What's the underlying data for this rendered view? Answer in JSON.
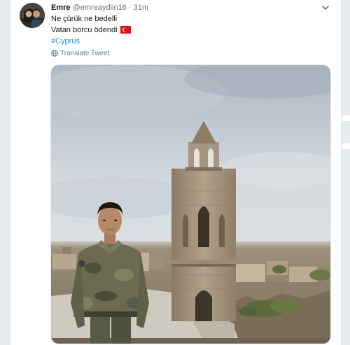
{
  "tweet": {
    "author_name": "Emre",
    "author_handle": "@emreaydiin16",
    "separator": " · ",
    "time": "31m",
    "lines": [
      "Ne çürük ne bedelli",
      "Vatan borcu ödendi"
    ],
    "hashtag": "#Cyprus",
    "translate_label": "Translate Tweet",
    "icons": {
      "more": "chevron-down-icon",
      "flag": "turkish-flag-icon",
      "translate": "globe-icon"
    }
  },
  "colors": {
    "link": "#1b95e0",
    "meta": "#657786",
    "text": "#14171a",
    "border": "#e1e8ed",
    "flag_red": "#e30a17"
  }
}
